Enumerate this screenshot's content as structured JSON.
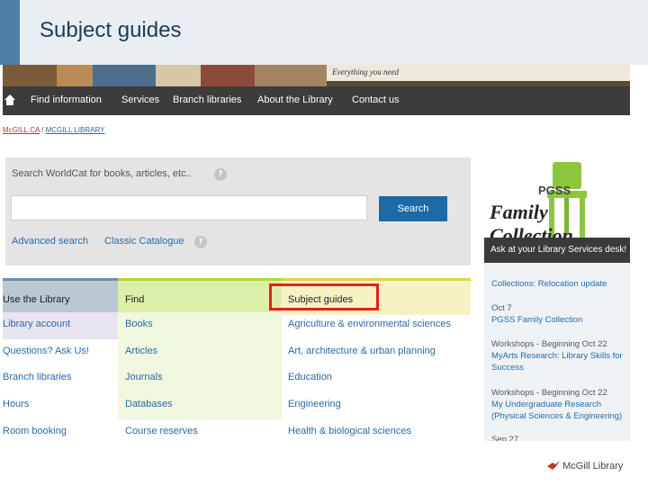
{
  "slide": {
    "title": "Subject guides",
    "footer_logo": "McGill Library"
  },
  "banner": {
    "tagline": "Everything you need"
  },
  "nav": {
    "items": [
      "Find information",
      "Services",
      "Branch libraries",
      "About the Library",
      "Contact us"
    ]
  },
  "breadcrumb": {
    "root": "McGILL.CA",
    "separator": "/",
    "current": "MCGILL LIBRARY"
  },
  "search": {
    "label": "Search WorldCat for books, articles, etc..",
    "help": "?",
    "value": "",
    "button": "Search",
    "advanced": "Advanced search",
    "classic": "Classic Catalogue"
  },
  "columns": [
    {
      "header": "Use the Library",
      "items": [
        "Library account",
        "Questions? Ask Us!",
        "Branch libraries",
        "Hours",
        "Room booking"
      ]
    },
    {
      "header": "Find",
      "items": [
        "Books",
        "Articles",
        "Journals",
        "Databases",
        "Course reserves"
      ]
    },
    {
      "header": "Subject guides",
      "items": [
        "Agriculture & environmental sciences",
        "Art, architecture & urban planning",
        "Education",
        "Engineering",
        "Health & biological sciences"
      ]
    }
  ],
  "sidebar": {
    "promo_line1": "PGSS",
    "promo_line2": "Family Collection",
    "bar": "Ask at your Library Services desk!",
    "news": [
      {
        "date": "",
        "text": "Collections: Relocation update"
      },
      {
        "date": "Oct 7",
        "text": "PGSS Family Collection"
      },
      {
        "date": "Workshops - Beginning Oct 22",
        "text": "MyArts Research: Library Skills for Success"
      },
      {
        "date": "Workshops - Beginning Oct 22",
        "text": "My Undergraduate Research (Physical Sciences & Engineering)"
      },
      {
        "date": "Sep 27",
        "text": ""
      }
    ]
  },
  "colors": {
    "highlight": "#e51f1f",
    "nav_bg": "#3c3c3c",
    "link": "#2a6aa8",
    "search_button": "#1c6aa7"
  }
}
